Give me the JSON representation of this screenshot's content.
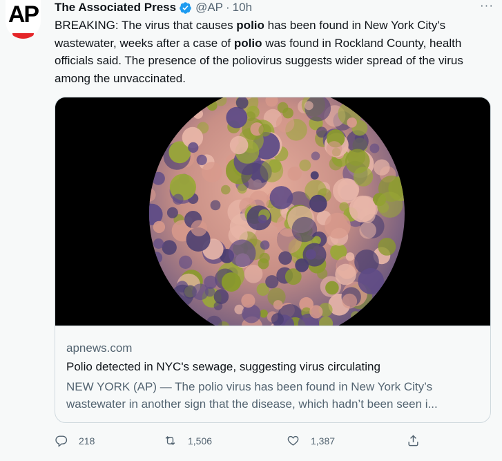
{
  "tweet": {
    "author_name": "The Associated Press",
    "handle": "@AP",
    "separator": "·",
    "time": "10h",
    "avatar_logo": "AP",
    "more_icon": "more-horizontal-icon",
    "text": {
      "p1": "BREAKING: The virus that causes ",
      "b1": "polio",
      "p2": " has been found in New York City's wastewater, weeks after a case of ",
      "b2": "polio",
      "p3": " was found in Rockland County, health officials said. The presence of the poliovirus suggests wider spread of the virus among the unvaccinated."
    }
  },
  "card": {
    "domain": "apnews.com",
    "title": "Polio detected in NYC's sewage, suggesting virus circulating",
    "description": "NEW YORK (AP) — The polio virus has been found in New York City’s wastewater in another sign that the disease, which hadn’t been seen i..."
  },
  "actions": {
    "reply_count": "218",
    "retweet_count": "1,506",
    "like_count": "1,387"
  },
  "colors": {
    "accent": "#1d9bf0",
    "muted": "#536471",
    "ap_red": "#e52629",
    "virus_pink": "#d89a8c",
    "virus_olive": "#8a9a2c",
    "virus_purple": "#5e4b86"
  }
}
